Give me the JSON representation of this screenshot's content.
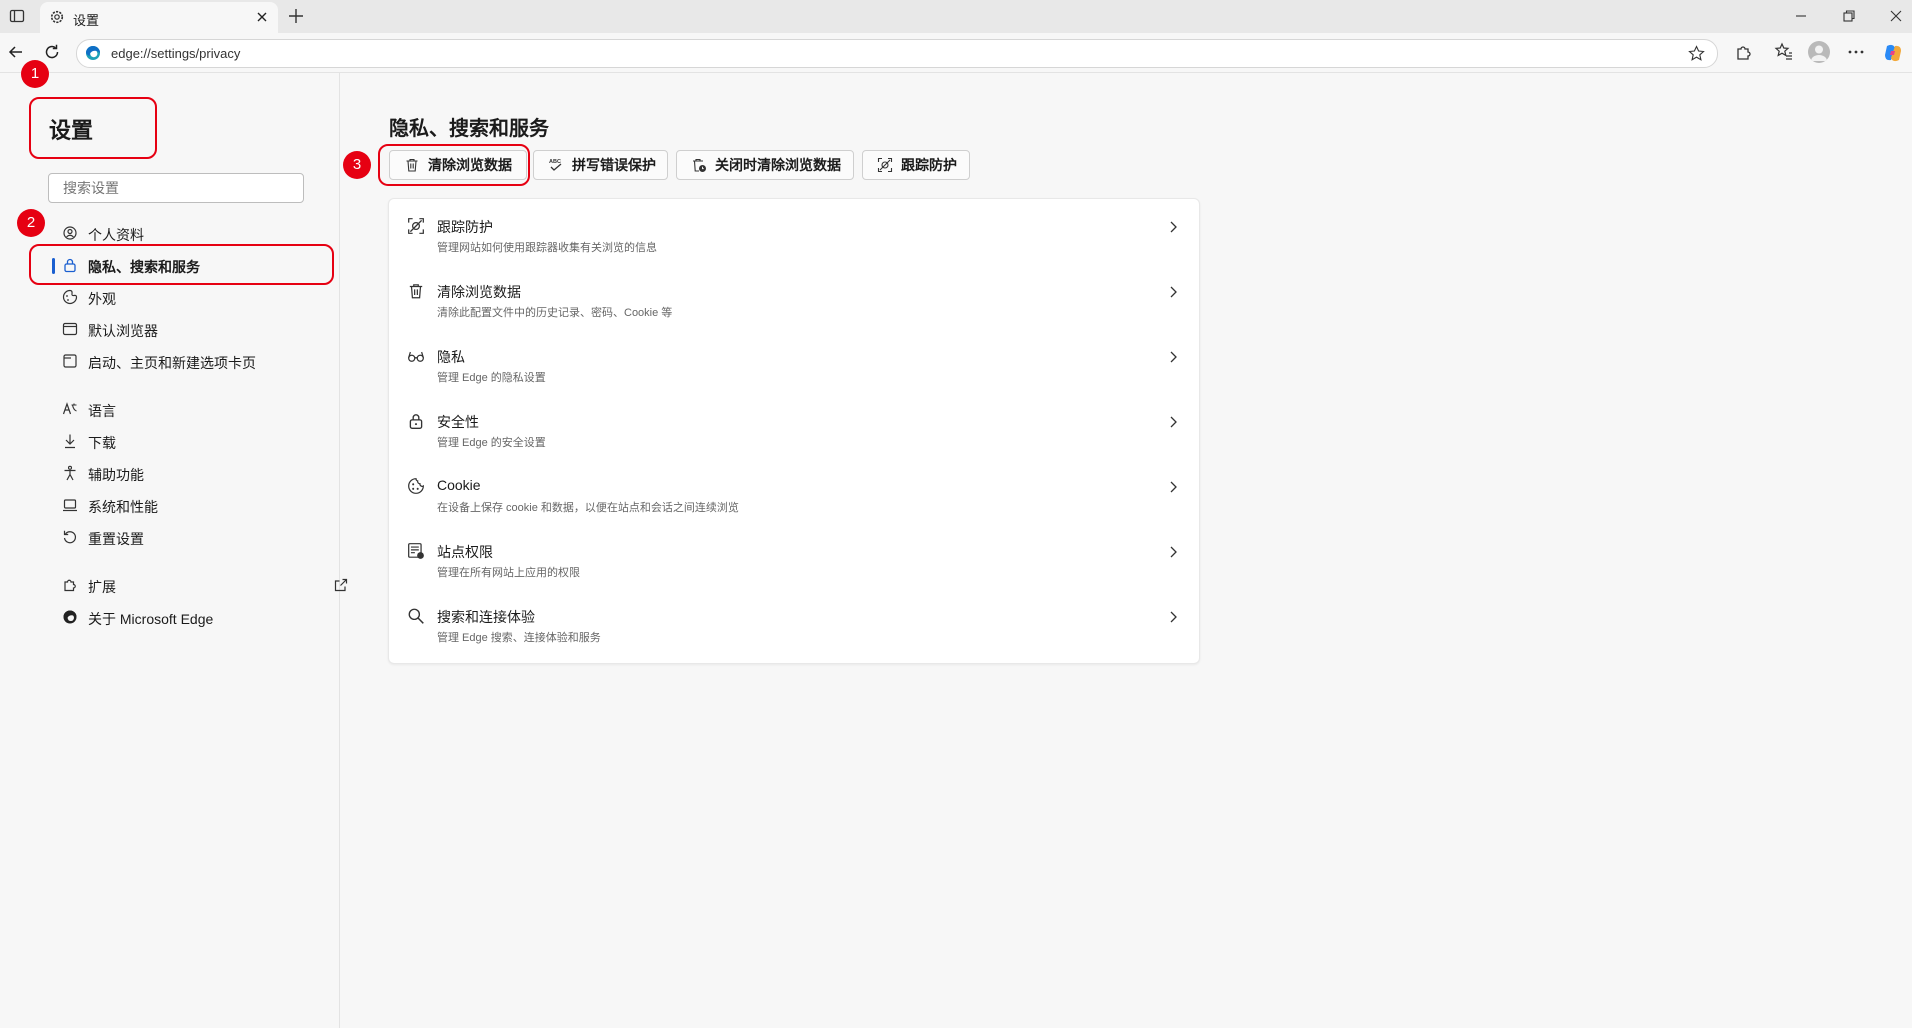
{
  "tab": {
    "title": "设置"
  },
  "address": {
    "url": "edge://settings/privacy"
  },
  "sidebar": {
    "title": "设置",
    "search_placeholder": "搜索设置",
    "items": [
      {
        "label": "个人资料",
        "icon": "profile-icon"
      },
      {
        "label": "隐私、搜索和服务",
        "icon": "lock-icon",
        "active": true
      },
      {
        "label": "外观",
        "icon": "appearance-icon"
      },
      {
        "label": "默认浏览器",
        "icon": "browser-icon"
      },
      {
        "label": "启动、主页和新建选项卡页",
        "icon": "home-icon"
      },
      {
        "label": "语言",
        "icon": "language-icon"
      },
      {
        "label": "下载",
        "icon": "download-icon"
      },
      {
        "label": "辅助功能",
        "icon": "accessibility-icon"
      },
      {
        "label": "系统和性能",
        "icon": "laptop-icon"
      },
      {
        "label": "重置设置",
        "icon": "reset-icon"
      },
      {
        "label": "扩展",
        "icon": "extension-icon"
      },
      {
        "label": "关于 Microsoft Edge",
        "icon": "edge-logo-icon"
      }
    ]
  },
  "main": {
    "title": "隐私、搜索和服务",
    "chips": [
      {
        "label": "清除浏览数据",
        "icon": "trash-icon"
      },
      {
        "label": "拼写错误保护",
        "icon": "spellcheck-icon"
      },
      {
        "label": "关闭时清除浏览数据",
        "icon": "trash-clock-icon"
      },
      {
        "label": "跟踪防护",
        "icon": "tracking-icon"
      }
    ],
    "rows": [
      {
        "title": "跟踪防护",
        "desc": "管理网站如何使用跟踪器收集有关浏览的信息",
        "icon": "tracking-icon"
      },
      {
        "title": "清除浏览数据",
        "desc": "清除此配置文件中的历史记录、密码、Cookie 等",
        "icon": "trash-icon"
      },
      {
        "title": "隐私",
        "desc": "管理 Edge 的隐私设置",
        "icon": "glasses-icon"
      },
      {
        "title": "安全性",
        "desc": "管理 Edge 的安全设置",
        "icon": "lock-icon"
      },
      {
        "title": "Cookie",
        "desc": "在设备上保存 cookie 和数据，以便在站点和会话之间连续浏览",
        "icon": "cookie-icon"
      },
      {
        "title": "站点权限",
        "desc": "管理在所有网站上应用的权限",
        "icon": "site-permissions-icon"
      },
      {
        "title": "搜索和连接体验",
        "desc": "管理 Edge 搜索、连接体验和服务",
        "icon": "search-icon"
      }
    ]
  },
  "annotations": [
    "1",
    "2",
    "3"
  ],
  "colors": {
    "annotation": "#e60012",
    "accent": "#1a5fd0"
  }
}
